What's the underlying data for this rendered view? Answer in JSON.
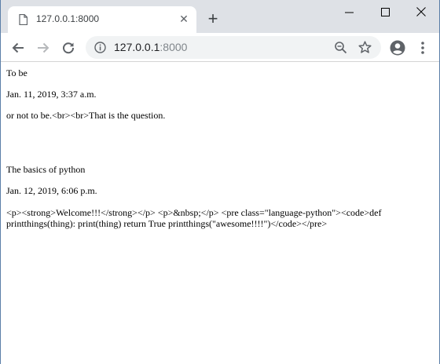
{
  "tab": {
    "title": "127.0.0.1:8000",
    "close": "✕"
  },
  "new_tab": "+",
  "address": {
    "host": "127.0.0.1",
    "port": ":8000"
  },
  "posts": [
    {
      "title": "To be",
      "date": "Jan. 11, 2019, 3:37 a.m.",
      "body": "or not to be.<br><br>That is the question."
    },
    {
      "title": "The basics of python",
      "date": "Jan. 12, 2019, 6:06 p.m.",
      "body": "<p><strong>Welcome!!!</strong></p> <p>&nbsp;</p> <pre class=\"language-python\"><code>def printthings(thing): print(thing) return True printthings(\"awesome!!!!\")</code></pre>"
    }
  ],
  "colors": {
    "tabstrip": "#dee1e6",
    "omnibox": "#f1f3f4",
    "window_border": "#5b7fa8"
  },
  "icons": [
    "page-icon",
    "close-icon",
    "plus-icon",
    "minimize-icon",
    "maximize-icon",
    "window-close-icon",
    "back-arrow-icon",
    "forward-arrow-icon",
    "reload-icon",
    "info-icon",
    "zoom-out-icon",
    "star-icon",
    "profile-icon",
    "kebab-menu-icon"
  ]
}
